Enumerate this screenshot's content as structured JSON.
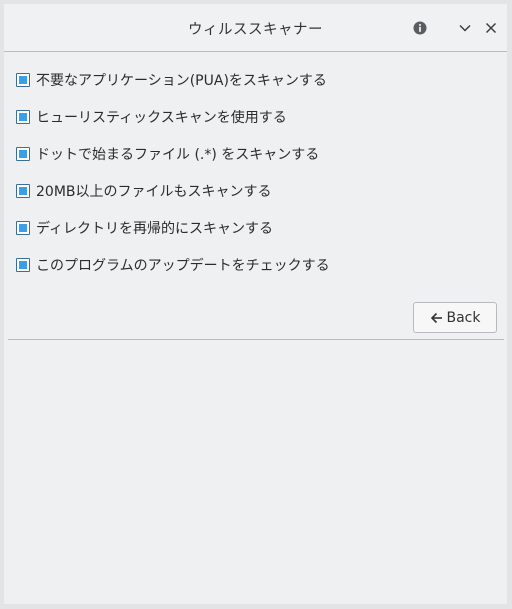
{
  "window": {
    "title": "ウィルススキャナー",
    "icons": {
      "info": "info-icon",
      "minimize": "chevron-down-icon",
      "close": "close-icon"
    }
  },
  "options": [
    {
      "label": "不要なアプリケーション(PUA)をスキャンする",
      "checked": true
    },
    {
      "label": "ヒューリスティックスキャンを使用する",
      "checked": true
    },
    {
      "label": "ドットで始まるファイル (.*) をスキャンする",
      "checked": true
    },
    {
      "label": "20MB以上のファイルもスキャンする",
      "checked": true
    },
    {
      "label": "ディレクトリを再帰的にスキャンする",
      "checked": true
    },
    {
      "label": "このプログラムのアップデートをチェックする",
      "checked": true
    }
  ],
  "back_button": {
    "label": "Back",
    "icon": "arrow-left-icon"
  },
  "colors": {
    "checkbox_fill": "#3b9ee8",
    "window_bg": "#eef0f2"
  }
}
